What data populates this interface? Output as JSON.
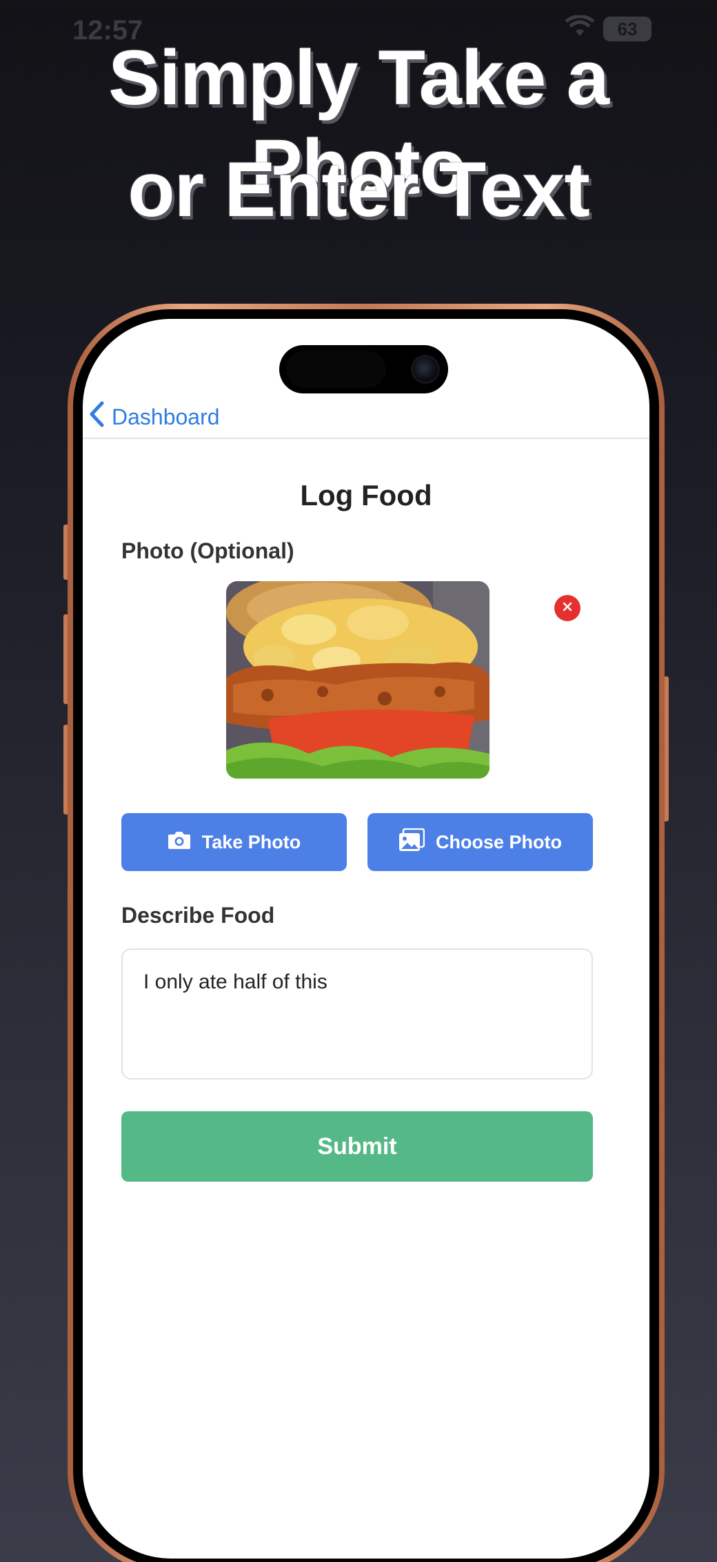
{
  "status_bar": {
    "time": "12:57",
    "battery": "63"
  },
  "headline": {
    "line1": "Simply Take a Photo",
    "line2": "or Enter Text"
  },
  "nav": {
    "back_label": "Dashboard"
  },
  "page": {
    "title": "Log Food"
  },
  "photo_section": {
    "label": "Photo (Optional)",
    "image_desc": "food-photo"
  },
  "buttons": {
    "take_photo": "Take Photo",
    "choose_photo": "Choose Photo",
    "submit": "Submit"
  },
  "describe": {
    "label": "Describe Food",
    "value": "I only ate half of this"
  },
  "colors": {
    "accent_blue": "#4d80e6",
    "link_blue": "#2f7de1",
    "submit_green": "#55b987",
    "remove_red": "#e53030"
  }
}
